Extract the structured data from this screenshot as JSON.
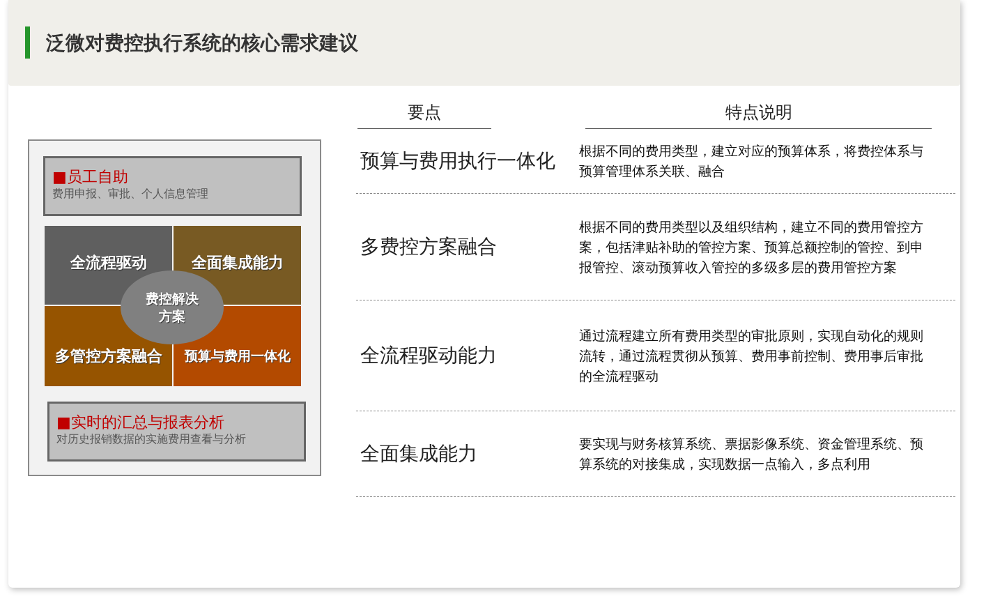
{
  "title": "泛微对费控执行系统的核心需求建议",
  "left_panel": {
    "top_box": {
      "heading": "■员工自助",
      "text": "费用申报、审批、个人信息管理"
    },
    "quadrants": [
      {
        "label": "全流程驱动",
        "color": "#5f5f5f"
      },
      {
        "label": "全面集成能力",
        "color": "#785a23"
      },
      {
        "label": "多管控方案融合",
        "color": "#965400"
      },
      {
        "label": "预算与费用一体化",
        "color": "#b34a00"
      }
    ],
    "center_label": "费控解决方案",
    "bottom_box": {
      "heading": "■实时的汇总与报表分析",
      "text": "对历史报销数据的实施费用查看与分析"
    }
  },
  "table": {
    "columns": [
      "要点",
      "特点说明"
    ],
    "rows": [
      {
        "point": "预算与费用执行一体化",
        "description": "根据不同的费用类型，建立对应的预算体系，将费控体系与预算管理体系关联、融合"
      },
      {
        "point": "多费控方案融合",
        "description": "根据不同的费用类型以及组织结构，建立不同的费用管控方案，包括津贴补助的管控方案、预算总额控制的管控、到申报管控、滚动预算收入管控的多级多层的费用管控方案"
      },
      {
        "point": "全流程驱动能力",
        "description": "通过流程建立所有费用类型的审批原则，实现自动化的规则流转，通过流程贯彻从预算、费用事前控制、费用事后审批的全流程驱动"
      },
      {
        "point": "全面集成能力",
        "description": "要实现与财务核算系统、票据影像系统、资金管理系统、预算系统的对接集成，实现数据一点输入，多点利用"
      }
    ]
  }
}
